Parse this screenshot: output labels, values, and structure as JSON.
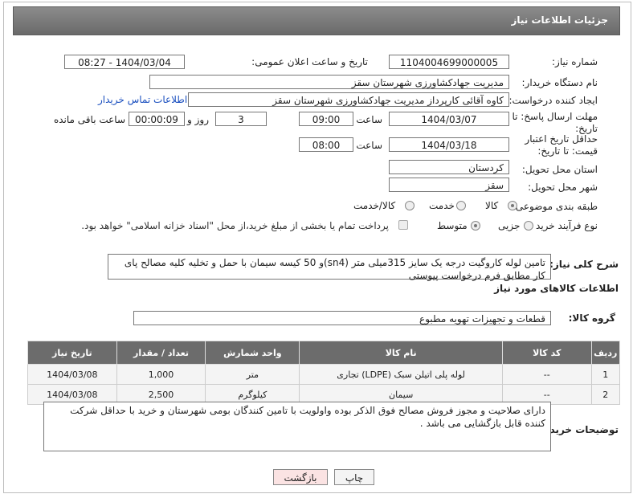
{
  "header": {
    "title": "جزئیات اطلاعات نیاز"
  },
  "labels": {
    "need_number": "شماره نیاز:",
    "announce_datetime": "تاریخ و ساعت اعلان عمومی:",
    "buyer_org": "نام دستگاه خریدار:",
    "requester": "ایجاد کننده درخواست:",
    "deadline": "مهلت ارسال پاسخ: تا تاریخ:",
    "min_validity": "حداقل تاریخ اعتبار قیمت: تا تاریخ:",
    "hour": "ساعت",
    "day_and": "روز و",
    "remaining": "ساعت باقی مانده",
    "province": "استان محل تحویل:",
    "city": "شهر محل تحویل:",
    "category": "طبقه بندی موضوعی:",
    "process": "نوع فرآیند خرید :",
    "general_desc": "شرح کلی نیاز:",
    "goods_info": "اطلاعات کالاهای مورد نیاز",
    "goods_group": "گروه کالا:",
    "buyer_notes": "توضیحات خریدار:"
  },
  "values": {
    "need_number": "1104004699000005",
    "announce_datetime": "1404/03/04 - 08:27",
    "buyer_org": "مدیریت جهادکشاورزی شهرستان سقز",
    "requester": "کاوه آقائی کارپرداز مدیریت جهادکشاورزی شهرستان سقز",
    "contact_link": "اطلاعات تماس خریدار",
    "deadline_date": "1404/03/07",
    "deadline_time": "09:00",
    "days": "3",
    "remaining_time": "00:00:09",
    "validity_date": "1404/03/18",
    "validity_time": "08:00",
    "province": "کردستان",
    "city": "سقز",
    "general_desc": "تامین لوله کاروگیت درجه یک سایز 315میلی متر (sn4)و 50 کیسه سیمان با حمل و تخلیه کلیه مصالح پای کار مطابق فرم درخواست پیوستی",
    "goods_group": "قطعات و تجهیزات تهویه مطبوع",
    "buyer_notes": "دارای صلاحیت و مجوز فروش مصالح فوق الذکر بوده واولویت با تامین کنندگان بومی شهرستان و خرید با حداقل شرکت کننده قابل بازگشایی می باشد ."
  },
  "category_options": [
    "کالا",
    "خدمت",
    "کالا/خدمت"
  ],
  "category_selected": "کالا",
  "process_options": [
    "جزیی",
    "متوسط"
  ],
  "process_selected": "متوسط",
  "process_note": "پرداخت تمام یا بخشی از مبلغ خرید،از محل \"اسناد خزانه اسلامی\" خواهد بود.",
  "table": {
    "headers": [
      "ردیف",
      "کد کالا",
      "نام کالا",
      "واحد شمارش",
      "تعداد / مقدار",
      "تاریخ نیاز"
    ],
    "rows": [
      [
        "1",
        "--",
        "لوله پلی اتیلن سبک (LDPE) تجاری",
        "متر",
        "1,000",
        "1404/03/08"
      ],
      [
        "2",
        "--",
        "سیمان",
        "کیلوگرم",
        "2,500",
        "1404/03/08"
      ]
    ]
  },
  "buttons": {
    "print": "چاپ",
    "back": "بازگشت"
  },
  "colors": {
    "header": "#777777",
    "back_button": "#fbe3e3",
    "link": "#1a4fbf"
  }
}
